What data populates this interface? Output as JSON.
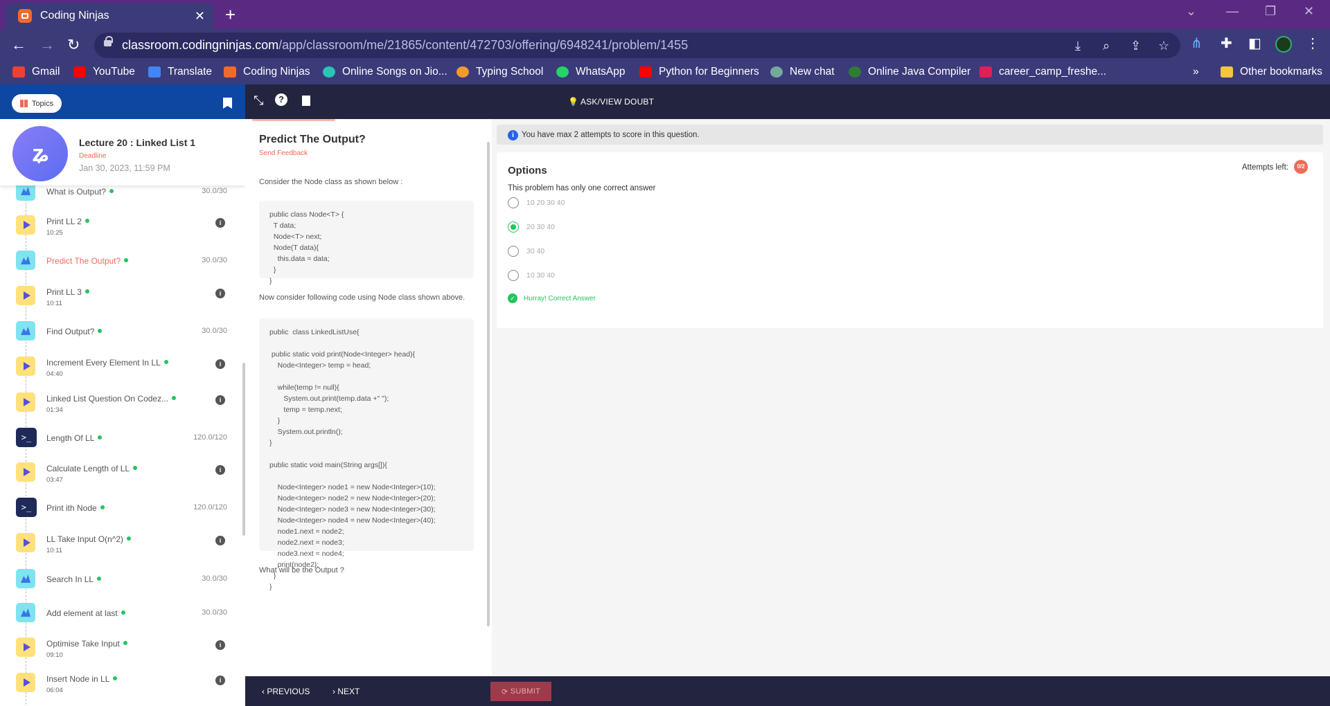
{
  "browser": {
    "tab_title": "Coding Ninjas",
    "url_host": "classroom.codingninjas.com",
    "url_path": "/app/classroom/me/21865/content/472703/offering/6948241/problem/1455",
    "bookmarks": [
      "Gmail",
      "YouTube",
      "Translate",
      "Coding Ninjas",
      "Online Songs on Jio...",
      "Typing School",
      "WhatsApp",
      "Python for Beginners",
      "New chat",
      "Online Java Compiler",
      "career_camp_freshe...",
      "Other bookmarks"
    ]
  },
  "header": {
    "topics_label": "Topics",
    "ask_doubt_label": "ASK/VIEW DOUBT"
  },
  "lecture": {
    "title": "Lecture 20 : Linked List 1",
    "deadline_label": "Deadline",
    "deadline_date": "Jan 30, 2023, 11:59 PM"
  },
  "sidebar_items": [
    {
      "name": "What is Output?",
      "type": "quiz",
      "score": "30.0/30"
    },
    {
      "name": "Print LL 2",
      "type": "video",
      "duration": "10:25"
    },
    {
      "name": "Predict The Output?",
      "type": "quiz",
      "score": "30.0/30",
      "active": true
    },
    {
      "name": "Print LL 3",
      "type": "video",
      "duration": "10:11"
    },
    {
      "name": "Find Output?",
      "type": "quiz",
      "score": "30.0/30"
    },
    {
      "name": "Increment Every Element In LL",
      "type": "video",
      "duration": "04:40"
    },
    {
      "name": "Linked List Question On Codez...",
      "type": "video",
      "duration": "01:34"
    },
    {
      "name": "Length Of LL",
      "type": "code",
      "score": "120.0/120"
    },
    {
      "name": "Calculate Length of LL",
      "type": "video",
      "duration": "03:47"
    },
    {
      "name": "Print ith Node",
      "type": "code",
      "score": "120.0/120"
    },
    {
      "name": "LL Take Input O(n^2)",
      "type": "video",
      "duration": "10:11"
    },
    {
      "name": "Search In LL",
      "type": "quiz",
      "score": "30.0/30"
    },
    {
      "name": "Add element at last",
      "type": "quiz",
      "score": "30.0/30"
    },
    {
      "name": "Optimise Take Input",
      "type": "video",
      "duration": "09:10"
    },
    {
      "name": "Insert Node in LL",
      "type": "video",
      "duration": "06:04"
    }
  ],
  "problem": {
    "title": "Predict The Output?",
    "feedback": "Send Feedback",
    "intro": "Consider the Node class as shown below :",
    "code1": "public class Node<T> {\n  T data;\n  Node<T> next;\n  Node(T data){\n    this.data = data;\n  }\n}",
    "middle": "Now consider following code using Node class shown above.",
    "code2": "public  class LinkedListUse{\n\n public static void print(Node<Integer> head){\n    Node<Integer> temp = head;\n\n    while(temp != null){\n       System.out.print(temp.data +\" \");\n       temp = temp.next;\n    }\n    System.out.println();\n}\n\npublic static void main(String args[]){\n\n    Node<Integer> node1 = new Node<Integer>(10);\n    Node<Integer> node2 = new Node<Integer>(20);\n    Node<Integer> node3 = new Node<Integer>(30);\n    Node<Integer> node4 = new Node<Integer>(40);\n    node1.next = node2;\n    node2.next = node3;\n    node3.next = node4;\n    print(node2);\n  }\n}",
    "question": "What will be the Output ?"
  },
  "answer": {
    "notice": "You have max 2 attempts to score in this question.",
    "options_title": "Options",
    "options_sub": "This problem has only one correct answer",
    "attempts_label": "Attempts left:",
    "attempts_value": "0/2",
    "options": [
      "10 20 30 40",
      "20 30 40",
      "30 40",
      "10 30 40"
    ],
    "selected_index": 1,
    "result": "Hurray! Correct Answer"
  },
  "footer": {
    "previous": "PREVIOUS",
    "next": "NEXT",
    "submit": "SUBMIT"
  }
}
